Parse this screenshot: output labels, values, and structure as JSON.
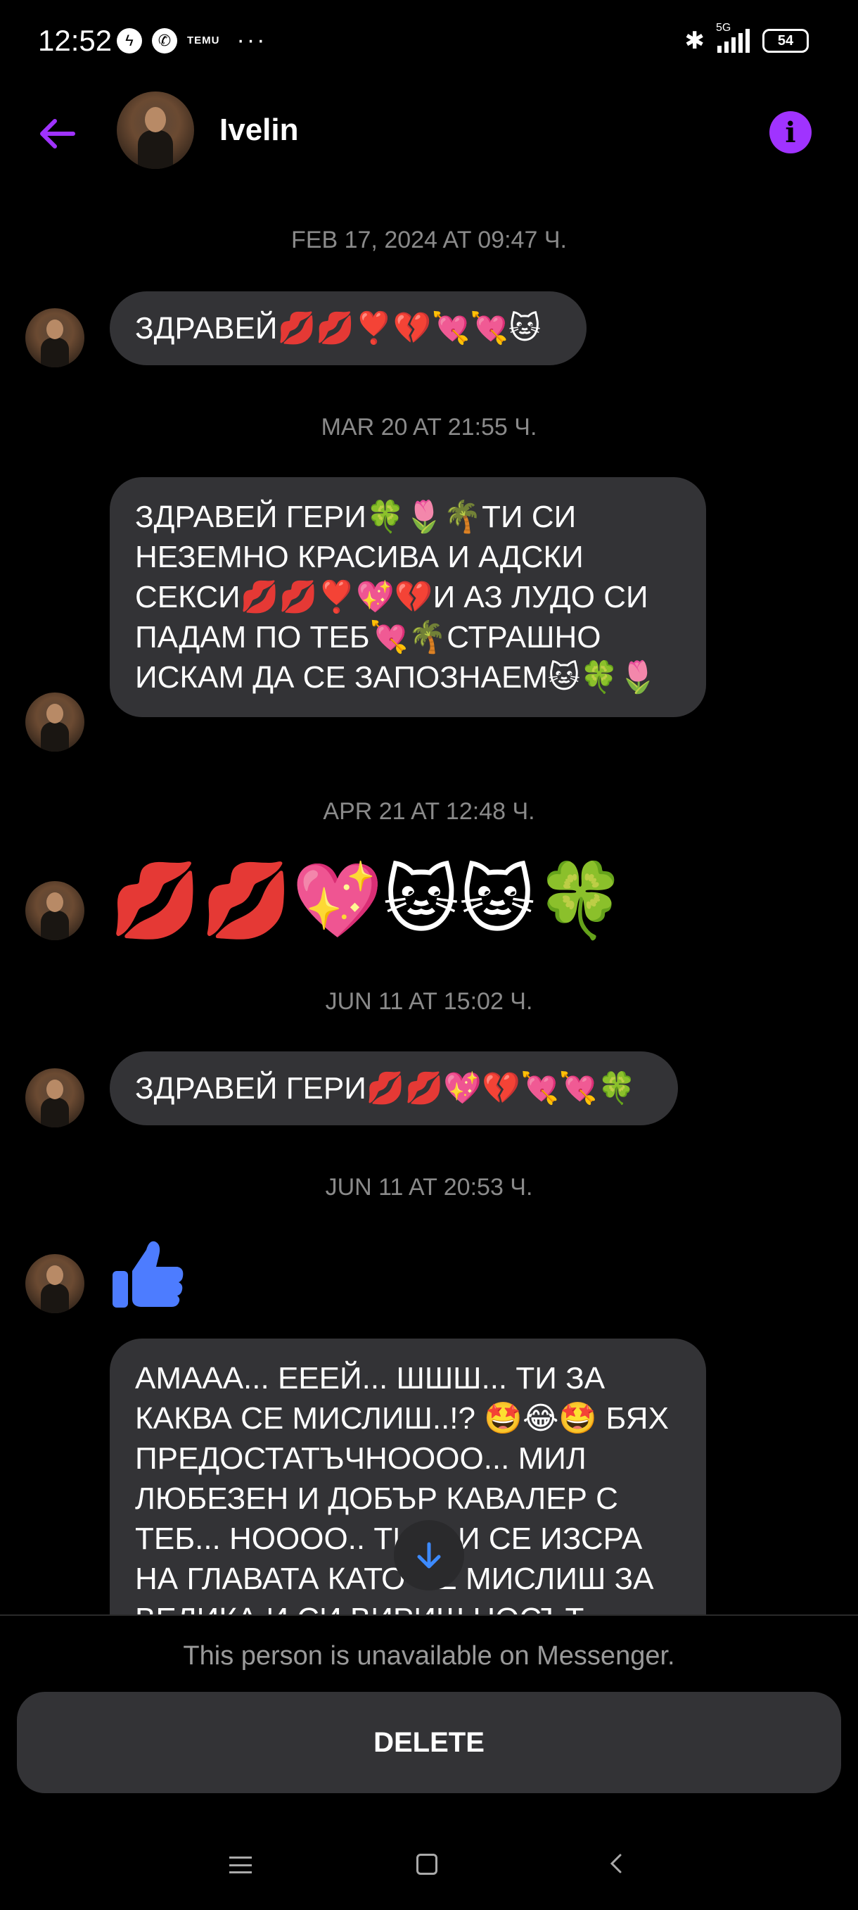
{
  "status_bar": {
    "time": "12:52",
    "left_icons": [
      "messenger-icon",
      "viber-icon",
      "temu-icon"
    ],
    "temu_label": "TEMU",
    "more": "···",
    "network": "5G",
    "battery": "54"
  },
  "header": {
    "contact_name": "Ivelin",
    "accent_color": "#a033ff"
  },
  "thread": {
    "timestamps": [
      "FEB 17, 2024 AT 09:47 Ч.",
      "MAR 20 AT 21:55 Ч.",
      "APR 21 AT 12:48 Ч.",
      "JUN 11 AT 15:02 Ч.",
      "JUN 11 AT 20:53 Ч."
    ],
    "messages": [
      {
        "text": "ЗДРАВЕЙ💋💋❣️💔💘💘🐱"
      },
      {
        "text": "ЗДРАВЕЙ ГЕРИ🍀🌷🌴ТИ СИ НЕЗЕМНО КРАСИВА И АДСКИ СЕКСИ💋💋❣️💖💔И АЗ ЛУДО СИ ПАДАМ ПО ТЕБ💘🌴СТРАШНО ИСКАМ ДА СЕ ЗАПОЗНАЕМ🐱🍀🌷"
      },
      {
        "text": "💋💋💖🐱🐱🍀"
      },
      {
        "text": "ЗДРАВЕЙ ГЕРИ💋💋💖💔💘💘🍀"
      },
      {
        "text": "thumbs-up"
      },
      {
        "text": "АМААА... ЕЕЕЙ... ШШШ... ТИ ЗА КАКВА СЕ МИСЛИШ..!? 🤩😂🤩 БЯХ ПРЕДОСТАТЪЧНОООО... МИЛ ЛЮБЕЗЕН И ДОБЪР КАВАЛЕР С ТЕБ... НОООО.. ТИ ... И СЕ ИЗСРА НА ГЛАВАТА КАТО СЕ МИСЛИШ ЗА ВЕЛИКА И СИ ВИРИШ НОСЪТ"
      }
    ]
  },
  "bottom": {
    "unavailable_text": "This person is unavailable on Messenger.",
    "delete_label": "DELETE"
  }
}
